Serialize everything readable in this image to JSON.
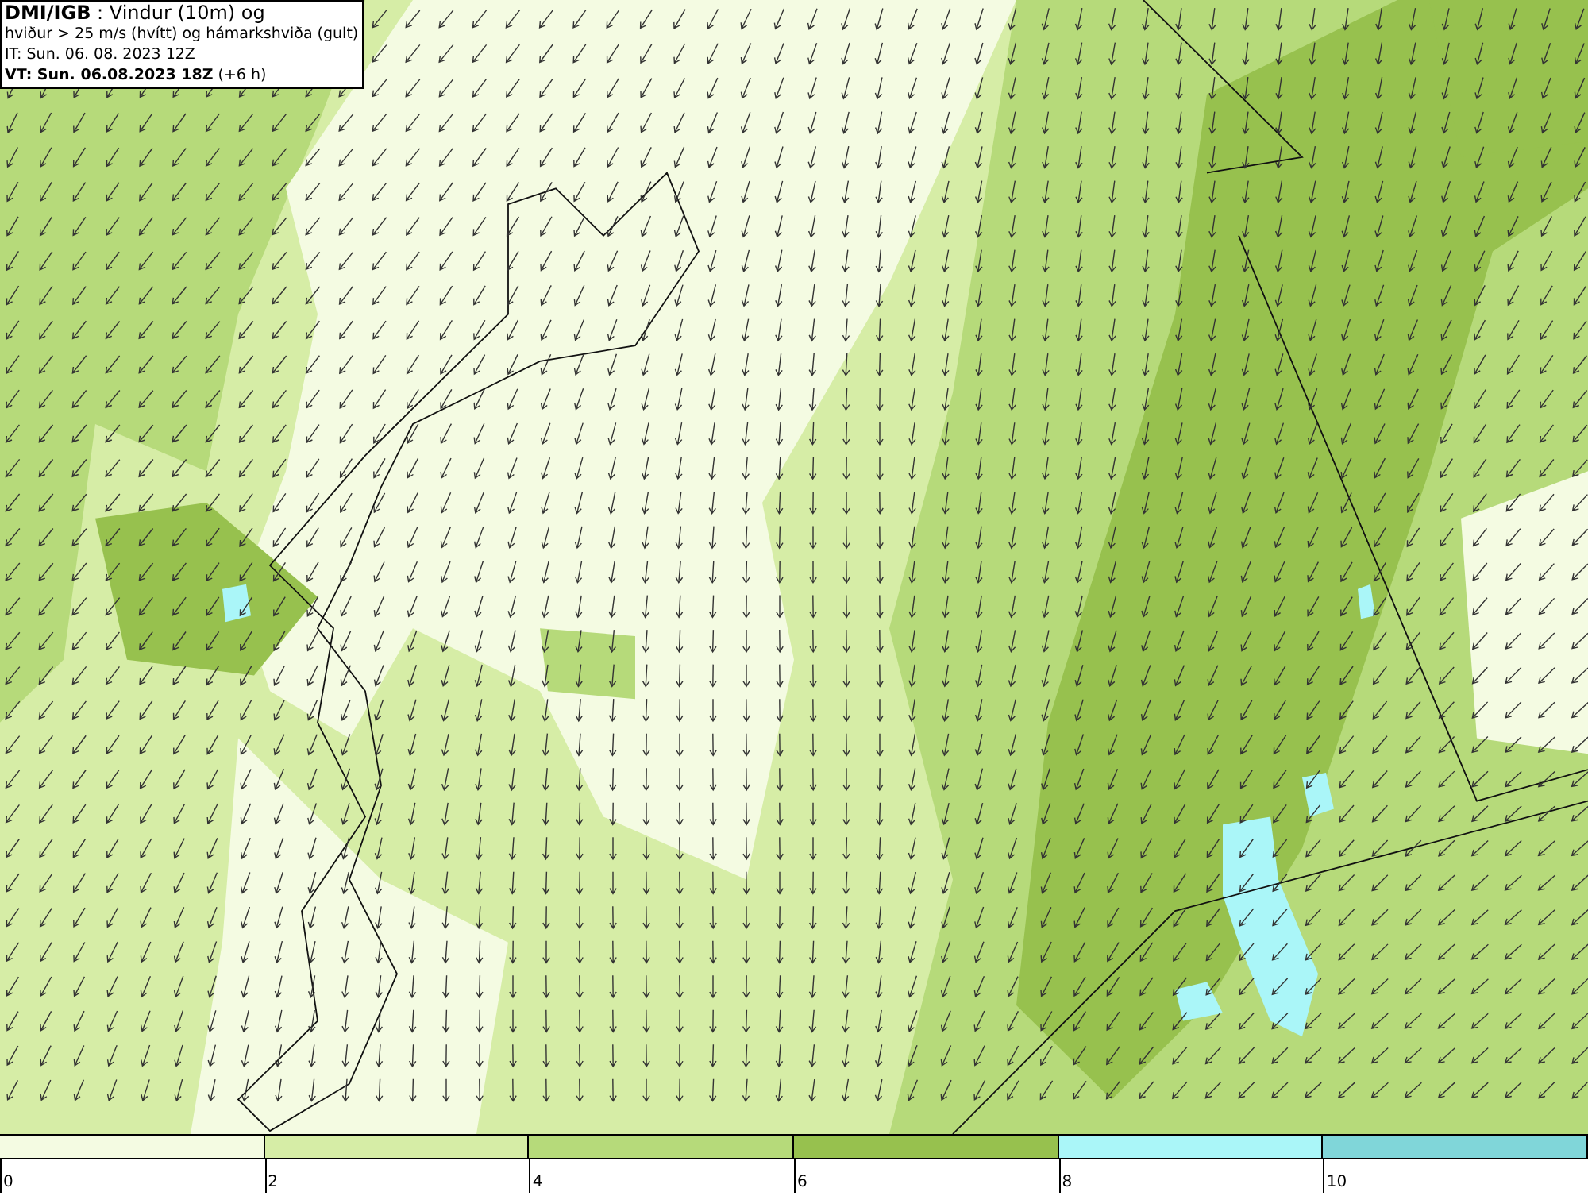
{
  "header": {
    "lines": [
      "**DMI/IGB** : Vindur (10m) og",
      "hviður > 25 m/s (hvítt) og hámarkshviða (gult)",
      "IT: Sun. 06. 08. 2023 12Z",
      "**VT: Sun. 06.08.2023 18Z** (+6 h)"
    ]
  },
  "legend": [
    {
      "label": "0",
      "color": "#f4fbe2"
    },
    {
      "label": "2",
      "color": "#d6eda6"
    },
    {
      "label": "4",
      "color": "#b6da7a"
    },
    {
      "label": "6",
      "color": "#97c14e"
    },
    {
      "label": "8",
      "color": "#aaf6f8"
    },
    {
      "label": "10",
      "color": "#80d6d9"
    }
  ]
}
